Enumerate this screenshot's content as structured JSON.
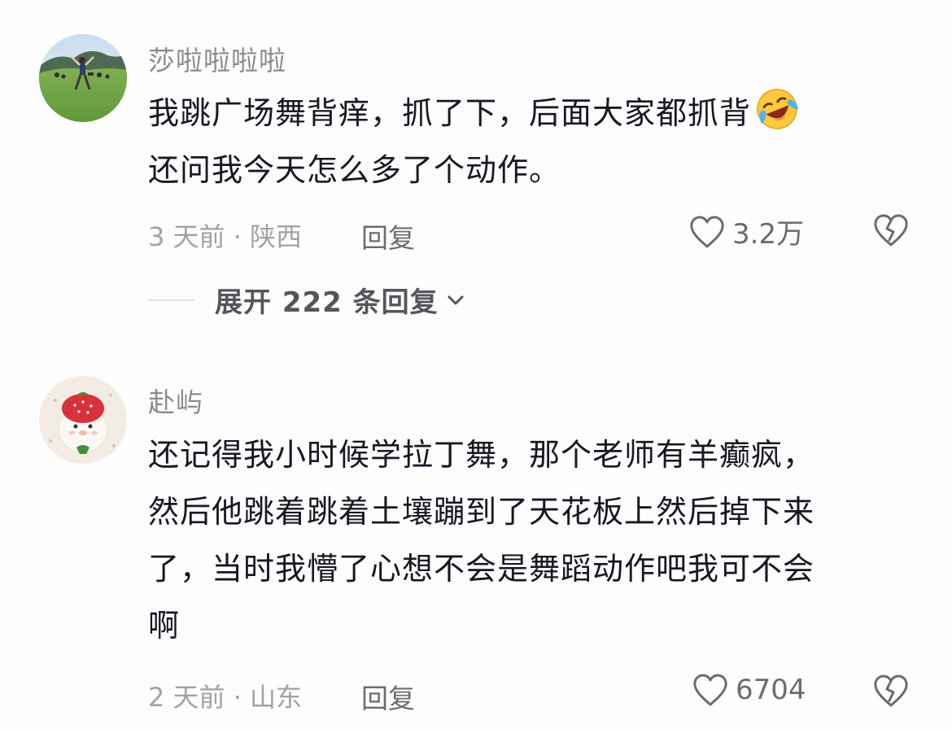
{
  "comments": [
    {
      "username": "莎啦啦啦啦",
      "lines": [
        "我跳广场舞背痒，抓了下，后面大家都抓背",
        "还问我今天怎么多了个动作。"
      ],
      "emoji": "laughing-crying-emoji",
      "time_location": "3 天前 · 陕西",
      "reply_label": "回复",
      "like_count": "3.2万",
      "expand_label": "展开 222 条回复"
    },
    {
      "username": "赴屿",
      "lines": [
        "还记得我小时候学拉丁舞，那个老师有羊癫疯，",
        "然后他跳着跳着土壤蹦到了天花板上然后掉下来",
        "了，当时我懵了心想不会是舞蹈动作吧我可不会",
        "啊"
      ],
      "time_location": "2 天前 · 山东",
      "reply_label": "回复",
      "like_count": "6704"
    }
  ],
  "icons": {
    "like": "heart-outline-icon",
    "dislike": "broken-heart-icon",
    "expand": "chevron-down-icon"
  },
  "colors": {
    "username": "#8a8b91",
    "body": "#161823",
    "meta": "#a1a2a7",
    "action": "#6b6c72"
  }
}
